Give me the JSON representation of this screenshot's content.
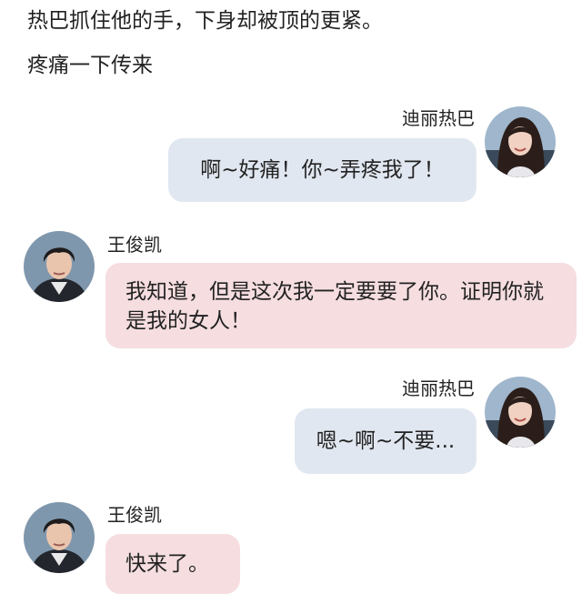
{
  "story": {
    "line1": "热巴抓住他的手，下身却被顶的更紧。",
    "line2": "疼痛一下传来"
  },
  "messages": [
    {
      "sender": "迪丽热巴",
      "text": "啊~好痛！你~弄疼我了！",
      "side": "right"
    },
    {
      "sender": "王俊凯",
      "text": "我知道，但是这次我一定要要了你。证明你就是我的女人！",
      "side": "left"
    },
    {
      "sender": "迪丽热巴",
      "text": "嗯~啊~不要...",
      "side": "right"
    },
    {
      "sender": "王俊凯",
      "text": "快来了。",
      "side": "left"
    }
  ],
  "colors": {
    "right_bubble": "#e1e7f0",
    "left_bubble": "#f5dde0",
    "text": "#222222"
  }
}
